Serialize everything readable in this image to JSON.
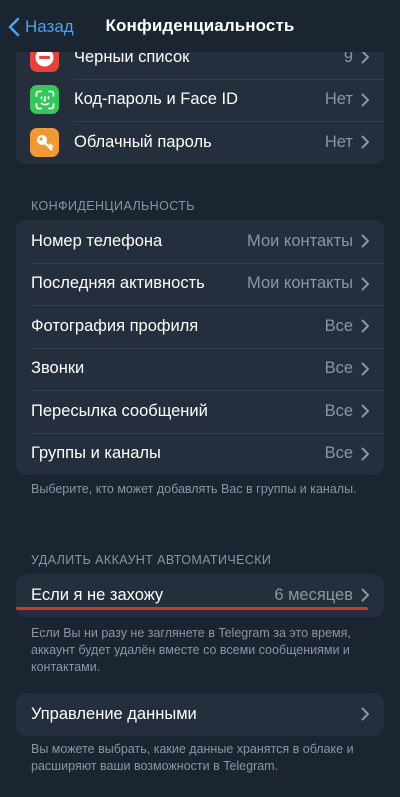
{
  "nav": {
    "back_label": "Назад",
    "title": "Конфиденциальность"
  },
  "security_group": {
    "items": [
      {
        "label": "Чёрный список",
        "value": "9",
        "icon": "block-icon",
        "color": "#e5423a"
      },
      {
        "label": "Код-пароль и Face ID",
        "value": "Нет",
        "icon": "face-id-icon",
        "color": "#35c759"
      },
      {
        "label": "Облачный пароль",
        "value": "Нет",
        "icon": "key-icon",
        "color": "#f09a37"
      }
    ]
  },
  "privacy_section": {
    "header": "КОНФИДЕНЦИАЛЬНОСТЬ",
    "items": [
      {
        "label": "Номер телефона",
        "value": "Мои контакты"
      },
      {
        "label": "Последняя активность",
        "value": "Мои контакты"
      },
      {
        "label": "Фотография профиля",
        "value": "Все"
      },
      {
        "label": "Звонки",
        "value": "Все"
      },
      {
        "label": "Пересылка сообщений",
        "value": "Все"
      },
      {
        "label": "Группы и каналы",
        "value": "Все"
      }
    ],
    "footer": "Выберите, кто может добавлять Вас в группы и каналы."
  },
  "auto_delete_section": {
    "header": "УДАЛИТЬ АККАУНТ АВТОМАТИЧЕСКИ",
    "item": {
      "label": "Если я не захожу",
      "value": "6 месяцев"
    },
    "footer": "Если Вы ни разу не заглянете в Telegram за это время, аккаунт будет удалён вместе со всеми сообщениями и контактами."
  },
  "data_section": {
    "item": {
      "label": "Управление данными"
    },
    "footer": "Вы можете выбрать, какие данные хранятся в облаке и расширяют ваши возможности в Telegram."
  },
  "colors": {
    "background": "#1b2431",
    "cell": "#242e3d",
    "accent": "#4aa3ef",
    "secondary_text": "#8b95a3",
    "highlight_underline": "#d6362a"
  }
}
